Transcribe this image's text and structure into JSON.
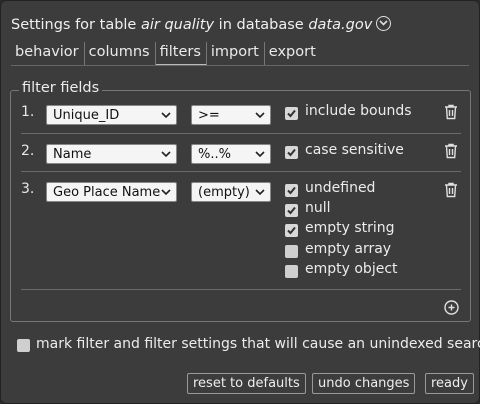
{
  "title": {
    "prefix": "Settings for table ",
    "table": "air quality",
    "middle": " in database ",
    "database": "data.gov"
  },
  "tabs": [
    "behavior",
    "columns",
    "filters",
    "import",
    "export"
  ],
  "active_tab": "filters",
  "filter_fields": {
    "legend": "filter fields",
    "rows": [
      {
        "num": "1.",
        "field": "Unique_ID",
        "op": ">=",
        "options": [
          {
            "label": "include bounds",
            "checked": true
          }
        ]
      },
      {
        "num": "2.",
        "field": "Name",
        "op": "%..%",
        "options": [
          {
            "label": "case sensitive",
            "checked": true
          }
        ]
      },
      {
        "num": "3.",
        "field": "Geo Place Name",
        "op": "(empty)",
        "options": [
          {
            "label": "undefined",
            "checked": true
          },
          {
            "label": "null",
            "checked": true
          },
          {
            "label": "empty string",
            "checked": true
          },
          {
            "label": "empty array",
            "checked": false
          },
          {
            "label": "empty object",
            "checked": false
          }
        ]
      }
    ]
  },
  "mark_unindexed": {
    "label": "mark filter and filter settings that will cause an unindexed search",
    "checked": false
  },
  "buttons": {
    "reset": "reset to defaults",
    "undo": "undo changes",
    "ready": "ready"
  },
  "icons": {
    "trash": "trash-icon",
    "add": "plus-circle-icon",
    "title_menu": "chevron-down-circle-icon"
  }
}
